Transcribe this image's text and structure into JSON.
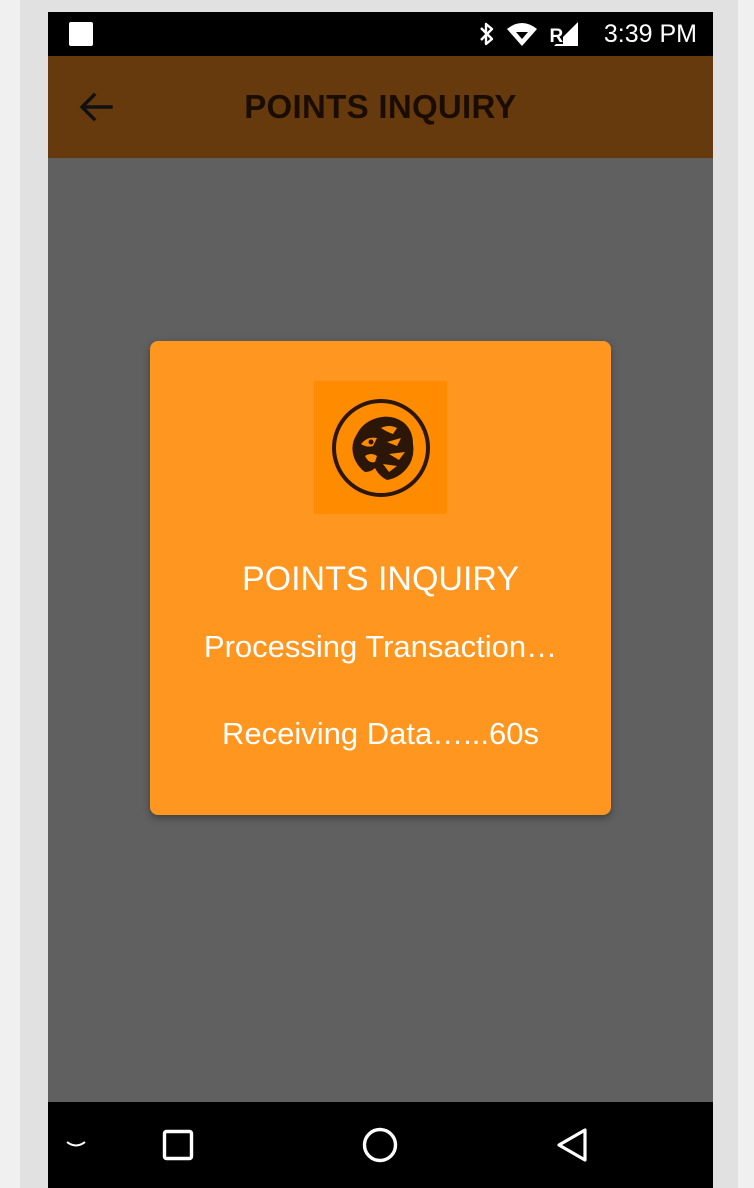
{
  "status_bar": {
    "time": "3:39 PM",
    "icons": [
      "notification-icon",
      "bluetooth-icon",
      "wifi-icon",
      "signal-icon"
    ]
  },
  "app_bar": {
    "title": "POINTS INQUIRY",
    "back_icon": "arrow-left-icon"
  },
  "dialog": {
    "logo": "tiger-logo-icon",
    "title": "POINTS INQUIRY",
    "status": "Processing Transaction…",
    "progress": "Receiving Data…...60s"
  },
  "nav_bar": {
    "items": [
      "keyboard-hide-icon",
      "recents-icon",
      "home-icon",
      "back-icon"
    ]
  },
  "colors": {
    "app_bar": "#663a0c",
    "dialog": "#fe9620",
    "logo_bg": "#ff8b00",
    "overlay": "#606060"
  }
}
